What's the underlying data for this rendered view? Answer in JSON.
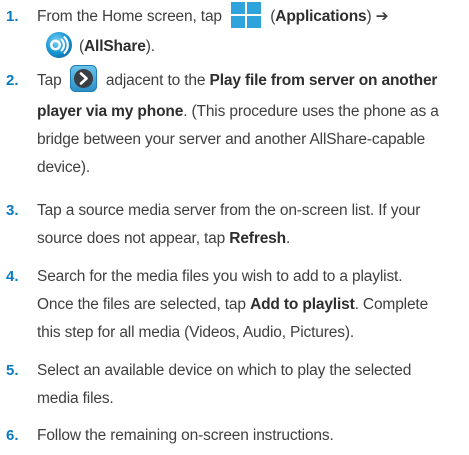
{
  "steps": [
    {
      "number": "1.",
      "text_a": "From the Home screen, tap",
      "icon_a": "applications-grid-icon",
      "paren_a_open": "(",
      "bold_a": "Applications",
      "paren_a_close": ") ➔",
      "icon_b": "allshare-icon",
      "paren_b_open": "(",
      "bold_b": "AllShare",
      "paren_b_close": ")."
    },
    {
      "number": "2.",
      "text_a": "Tap",
      "icon_a": "arrow-right-button-icon",
      "text_b": "adjacent to the",
      "bold_a1": "Play file from server on another",
      "bold_a2": "player via my phone",
      "text_c1": ". (This procedure uses the phone as a",
      "text_c2": "bridge between your server and another AllShare-capable",
      "text_c3": "device)."
    },
    {
      "number": "3.",
      "text_a1": "Tap a source media server from the on-screen list. If your",
      "text_a2": "source does not appear, tap",
      "bold_a": "Refresh",
      "text_b": "."
    },
    {
      "number": "4.",
      "text_a1": "Search for the media files you wish to add to a playlist.",
      "text_a2": "Once the files are selected, tap",
      "bold_a": "Add to playlist",
      "text_b": ". Complete",
      "text_c": "this step for all media (Videos, Audio, Pictures)."
    },
    {
      "number": "5.",
      "text_a1": "Select an available device on which to play the selected",
      "text_a2": "media files."
    },
    {
      "number": "6.",
      "text_a1": "Follow the remaining on-screen instructions."
    }
  ],
  "colors": {
    "step_number": "#0a7abf",
    "body_text": "#3f3f3f",
    "apps_icon_blue": "#2fa3dc",
    "allshare_icon_blue": "#1a9ad6",
    "arrow_button_blue": "#3aa6da"
  }
}
